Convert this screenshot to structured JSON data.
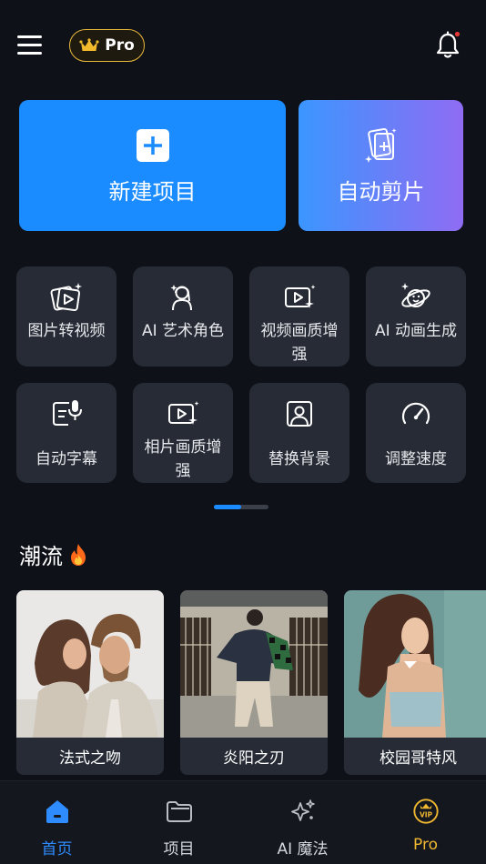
{
  "header": {
    "pro_badge": "Pro",
    "icons": {
      "menu": "hamburger-menu-icon",
      "crown": "crown-icon",
      "notification": "bell-icon"
    },
    "notification_dot_color": "#e53935"
  },
  "actions": {
    "new_project": "新建项目",
    "auto_edit": "自动剪片"
  },
  "tools": [
    {
      "label": "图片转视频",
      "icon": "photo-to-video-icon"
    },
    {
      "label": "AI 艺术角色",
      "icon": "ai-art-character-icon"
    },
    {
      "label": "视频画质增强",
      "icon": "video-enhance-icon"
    },
    {
      "label": "AI 动画生成",
      "icon": "ai-animation-icon"
    },
    {
      "label": "自动字幕",
      "icon": "auto-subtitle-icon"
    },
    {
      "label": "相片画质增强",
      "icon": "photo-enhance-icon"
    },
    {
      "label": "替换背景",
      "icon": "replace-background-icon"
    },
    {
      "label": "调整速度",
      "icon": "speed-icon"
    }
  ],
  "pager": {
    "pages": 2,
    "active": 1
  },
  "trending": {
    "title": "潮流",
    "cards": [
      {
        "caption": "法式之吻"
      },
      {
        "caption": "炎阳之刃"
      },
      {
        "caption": "校园哥特风"
      }
    ]
  },
  "bottom_nav": {
    "active_color": "#2f8cff",
    "pro_color": "#f0b731",
    "items": [
      {
        "label": "首页",
        "icon": "home-icon",
        "active": true
      },
      {
        "label": "项目",
        "icon": "folder-icon",
        "active": false
      },
      {
        "label": "AI 魔法",
        "icon": "sparkle-icon",
        "active": false
      },
      {
        "label": "Pro",
        "icon": "vip-icon",
        "active": false
      }
    ]
  }
}
